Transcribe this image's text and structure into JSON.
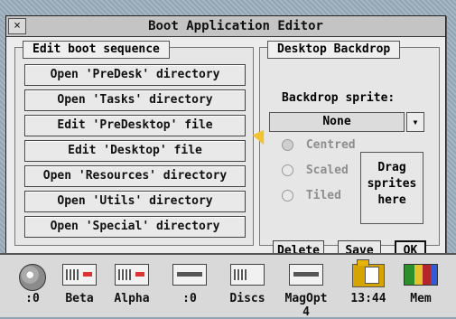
{
  "window": {
    "title": "Boot Application Editor",
    "close_glyph": "×"
  },
  "left_panel": {
    "label": "Edit boot sequence",
    "buttons": [
      "Open 'PreDesk' directory",
      "Open 'Tasks' directory",
      "Edit 'PreDesktop' file",
      "Edit 'Desktop' file",
      "Open 'Resources' directory",
      "Open 'Utils' directory",
      "Open 'Special' directory"
    ]
  },
  "right_panel": {
    "label": "Desktop Backdrop",
    "backdrop_label": "Backdrop sprite:",
    "sprite_value": "None",
    "menu_glyph": "▾",
    "radios": [
      {
        "label": "Centred",
        "selected": true
      },
      {
        "label": "Scaled",
        "selected": false
      },
      {
        "label": "Tiled",
        "selected": false
      }
    ],
    "drag_box_lines": [
      "Drag",
      "sprites",
      "here"
    ],
    "actions": {
      "delete": "Delete",
      "save": "Save",
      "ok": "OK"
    }
  },
  "iconbar": {
    "items": [
      {
        "label": ":0",
        "icon": "cd-icon"
      },
      {
        "label": "Beta",
        "icon": "drive-icon"
      },
      {
        "label": "Alpha",
        "icon": "drive-icon"
      },
      {
        "label": ":0",
        "icon": "floppy-icon"
      },
      {
        "label": "Discs",
        "icon": "discs-icon"
      },
      {
        "label": "MagOpt 4",
        "icon": "mag-icon"
      },
      {
        "label": "13:44",
        "icon": "clock-icon"
      },
      {
        "label": "Mem",
        "icon": "memory-icon"
      }
    ]
  }
}
